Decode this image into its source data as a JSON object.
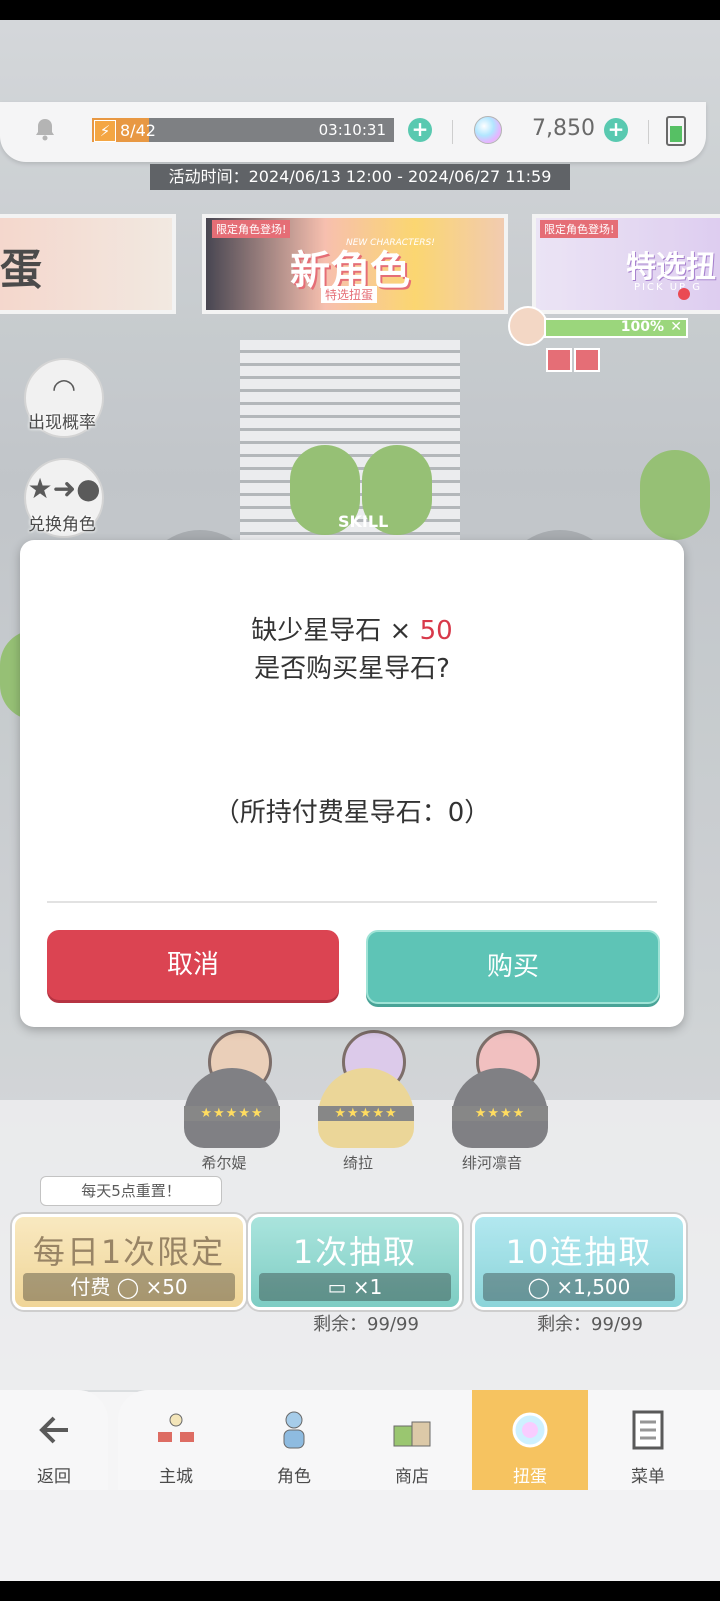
{
  "status": {
    "stamina": "8/42",
    "stamina_timer": "03:10:31",
    "gems": "7,850",
    "stamina_fraction": 0.19
  },
  "event_time": "活动时间：2024/06/13 12:00 - 2024/06/27 11:59",
  "banners": {
    "left_char": "蛋",
    "main_tag": "限定角色登场!",
    "main_title": "新角色",
    "main_english": "NEW CHARACTERS!",
    "main_sub": "特选扭蛋",
    "right_tag": "限定角色登场!",
    "right_title": "特选扭",
    "right_pickup": "PICK UP G"
  },
  "progress": {
    "label": "100%",
    "value": 1.0
  },
  "side": {
    "rate_label": "出现概率",
    "exchange_label": "兑换角色"
  },
  "skill_label": "SKILL",
  "dialog": {
    "line1_prefix": "缺少星导石 × ",
    "line1_count": "50",
    "line2": "是否购买星导石?",
    "owned": "（所持付费星导石：0）",
    "cancel": "取消",
    "buy": "购买"
  },
  "characters": [
    {
      "name": "希尔媞",
      "stars": "★★★★★"
    },
    {
      "name": "绮拉",
      "stars": "★★★★★"
    },
    {
      "name": "绯河凛音",
      "stars": "★★★★"
    }
  ],
  "draw": {
    "reset_tip": "每天5点重置！",
    "daily_title": "每日1次限定",
    "daily_cost": "付费 ◯ ×50",
    "single_title": "1次抽取",
    "single_cost": "▭ ×1",
    "ten_title": "10连抽取",
    "ten_cost": "◯ ×1,500",
    "single_remain": "剩余：99/99",
    "ten_remain": "剩余：99/99"
  },
  "nav": {
    "back": "返回",
    "city": "主城",
    "characters": "角色",
    "shop": "商店",
    "gacha": "扭蛋",
    "menu": "菜单"
  },
  "colors": {
    "cancel": "#db4452",
    "buy": "#5ec4b6",
    "accent_red": "#d8394a",
    "nav_active": "#f5bb4b"
  },
  "icons": [
    "bell-icon",
    "lightning-icon",
    "plus-icon",
    "gem-icon",
    "battery-icon",
    "back-arrow-icon",
    "castle-icon",
    "character-icon",
    "shop-icon",
    "gacha-icon",
    "menu-icon"
  ]
}
